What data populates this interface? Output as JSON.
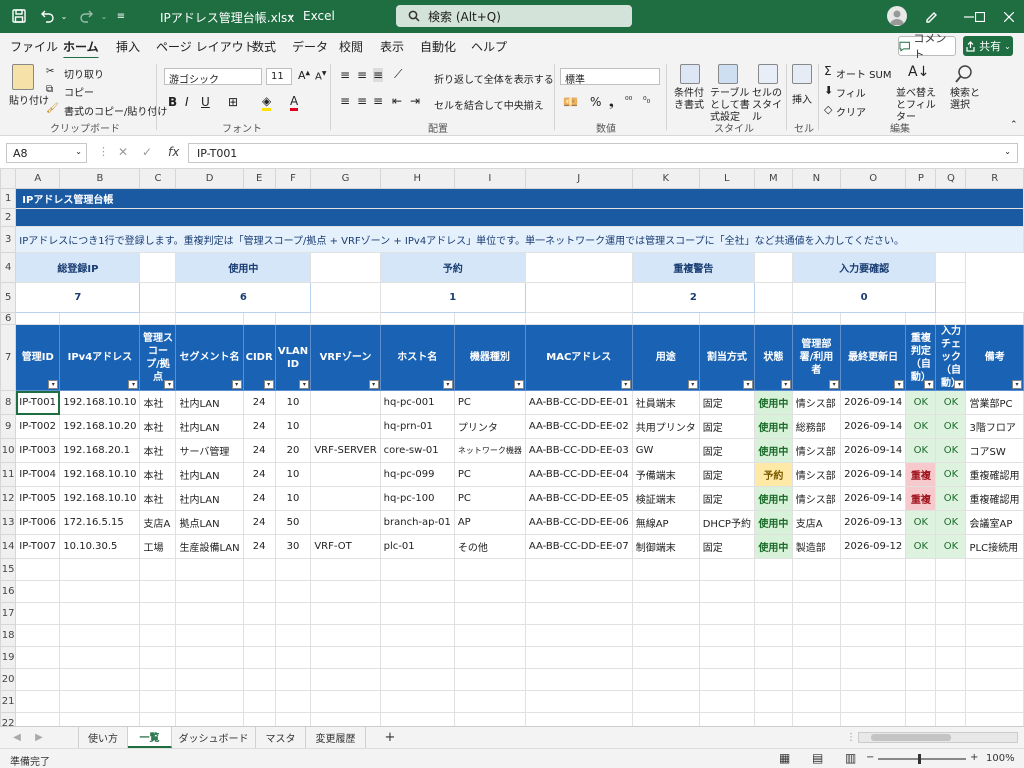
{
  "window": {
    "file_name": "IPアドレス管理台帳.xlsx",
    "dropdown": "⌄",
    "app_name": "Excel",
    "search_placeholder": "検索 (Alt+Q)"
  },
  "menu": {
    "items": [
      "ファイル",
      "ホーム",
      "挿入",
      "ページ レイアウト",
      "数式",
      "データ",
      "校閲",
      "表示",
      "自動化",
      "ヘルプ"
    ],
    "active": "ホーム",
    "comment_label": "コメント",
    "share_label": "共有"
  },
  "ribbon": {
    "paste": "貼り付け",
    "cut": "切り取り",
    "copy": "コピー",
    "format_painter": "書式のコピー/貼り付け",
    "clipboard_group": "クリップボード",
    "font_name": "游ゴシック",
    "font_size": "11",
    "font_group": "フォント",
    "wrap_text": "折り返して全体を表示する",
    "merge_center": "セルを結合して中央揃え",
    "alignment_group": "配置",
    "number_format": "標準",
    "number_group": "数値",
    "conditional_format": "条件付き書式",
    "table_format": "テーブルとして書式設定",
    "cell_style": "セルのスタイル",
    "style_group": "スタイル",
    "insert": "挿入",
    "autosum": "オート SUM",
    "fill": "フィル",
    "clear": "クリア",
    "sort_filter": "並べ替えとフィルター",
    "find_select": "検索と選択",
    "edit_group": "編集",
    "cells_group": "セル"
  },
  "formula_bar": {
    "name_box": "A8",
    "fx": "fx",
    "value": "IP-T001"
  },
  "columns": [
    "A",
    "B",
    "C",
    "D",
    "E",
    "F",
    "G",
    "H",
    "I",
    "J",
    "K",
    "L",
    "M",
    "N",
    "O",
    "P",
    "Q",
    "R"
  ],
  "rows": [
    "1",
    "2",
    "3",
    "4",
    "5",
    "6",
    "7",
    "8",
    "9",
    "10",
    "11",
    "12",
    "13",
    "14",
    "15",
    "16",
    "17",
    "18",
    "19",
    "20",
    "21",
    "22"
  ],
  "sheet": {
    "title": "IPアドレス管理台帳",
    "note": "IPアドレスにつき1行で登録します。重複判定は「管理スコープ/拠点 + VRFゾーン + IPv4アドレス」単位です。単一ネットワーク運用では管理スコープに「全社」など共通値を入力してください。",
    "kpis": [
      {
        "label": "総登録IP",
        "value": "7"
      },
      {
        "label": "使用中",
        "value": "6"
      },
      {
        "label": "予約",
        "value": "1"
      },
      {
        "label": "重複警告",
        "value": "2"
      },
      {
        "label": "入力要確認",
        "value": "0"
      }
    ],
    "headers": [
      "管理ID",
      "IPv4アドレス",
      "管理スコープ/拠点",
      "セグメント名",
      "CIDR",
      "VLAN ID",
      "VRFゾーン",
      "ホスト名",
      "機器種別",
      "MACアドレス",
      "用途",
      "割当方式",
      "状態",
      "管理部署/利用者",
      "最終更新日",
      "重複判定（自動）",
      "入力チェック（自動）",
      "備考"
    ],
    "records": [
      [
        "IP-T001",
        "192.168.10.10",
        "本社",
        "社内LAN",
        "24",
        "10",
        "",
        "hq-pc-001",
        "PC",
        "AA-BB-CC-DD-EE-01",
        "社員端末",
        "固定",
        "使用中",
        "情シス部",
        "2026-09-14",
        "OK",
        "OK",
        "営業部PC"
      ],
      [
        "IP-T002",
        "192.168.10.20",
        "本社",
        "社内LAN",
        "24",
        "10",
        "",
        "hq-prn-01",
        "プリンタ",
        "AA-BB-CC-DD-EE-02",
        "共用プリンタ",
        "固定",
        "使用中",
        "総務部",
        "2026-09-14",
        "OK",
        "OK",
        "3階フロア"
      ],
      [
        "IP-T003",
        "192.168.20.1",
        "本社",
        "サーバ管理",
        "24",
        "20",
        "VRF-SERVER",
        "core-sw-01",
        "ネットワーク機器",
        "AA-BB-CC-DD-EE-03",
        "GW",
        "固定",
        "使用中",
        "情シス部",
        "2026-09-14",
        "OK",
        "OK",
        "コアSW"
      ],
      [
        "IP-T004",
        "192.168.10.10",
        "本社",
        "社内LAN",
        "24",
        "10",
        "",
        "hq-pc-099",
        "PC",
        "AA-BB-CC-DD-EE-04",
        "予備端末",
        "固定",
        "予約",
        "情シス部",
        "2026-09-14",
        "重複",
        "OK",
        "重複確認用"
      ],
      [
        "IP-T005",
        "192.168.10.10",
        "本社",
        "社内LAN",
        "24",
        "10",
        "",
        "hq-pc-100",
        "PC",
        "AA-BB-CC-DD-EE-05",
        "検証端末",
        "固定",
        "使用中",
        "情シス部",
        "2026-09-14",
        "重複",
        "OK",
        "重複確認用"
      ],
      [
        "IP-T006",
        "172.16.5.15",
        "支店A",
        "拠点LAN",
        "24",
        "50",
        "",
        "branch-ap-01",
        "AP",
        "AA-BB-CC-DD-EE-06",
        "無線AP",
        "DHCP予約",
        "使用中",
        "支店A",
        "2026-09-13",
        "OK",
        "OK",
        "会議室AP"
      ],
      [
        "IP-T007",
        "10.10.30.5",
        "工場",
        "生産設備LAN",
        "24",
        "30",
        "VRF-OT",
        "plc-01",
        "その他",
        "AA-BB-CC-DD-EE-07",
        "制御端末",
        "固定",
        "使用中",
        "製造部",
        "2026-09-12",
        "OK",
        "OK",
        "PLC接続用"
      ]
    ]
  },
  "tabs": {
    "items": [
      "使い方",
      "一覧",
      "ダッシュボード",
      "マスタ",
      "変更履歴"
    ],
    "active": "一覧",
    "add": "+"
  },
  "status": {
    "ready": "準備完了",
    "zoom": "100%",
    "minus": "−",
    "plus": "+"
  },
  "colors": {
    "excel_green": "#1e6e42",
    "header_blue": "#1a63b4",
    "title_blue": "#1a5aa2"
  }
}
